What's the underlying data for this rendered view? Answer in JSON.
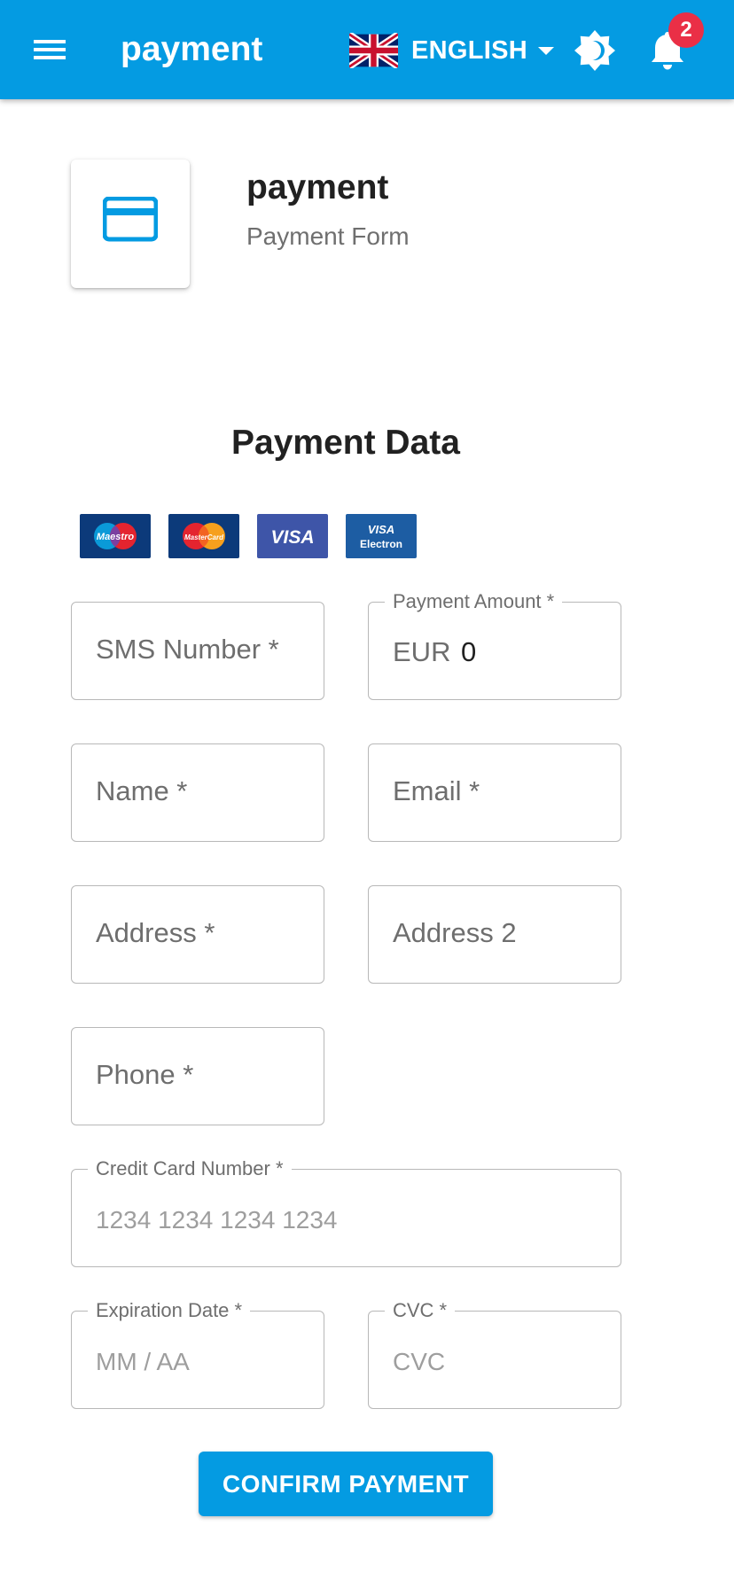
{
  "appbar": {
    "title": "payment",
    "language": "ENGLISH",
    "notification_count": "2",
    "background_color": "#049be2",
    "icons": {
      "menu": "hamburger-menu-icon",
      "flag": "uk-flag-icon",
      "theme": "brightness-toggle-icon",
      "notifications": "bell-icon"
    }
  },
  "header": {
    "icon": "credit-card-icon",
    "title": "payment",
    "subtitle": "Payment Form"
  },
  "form": {
    "section_title": "Payment Data",
    "card_brands": [
      {
        "name": "Maestro",
        "label": "Maestro"
      },
      {
        "name": "MasterCard",
        "label": "MasterCard"
      },
      {
        "name": "Visa",
        "label": "VISA"
      },
      {
        "name": "Visa Electron",
        "label_top": "VISA",
        "label_bottom": "Electron"
      }
    ],
    "sms_number": {
      "placeholder": "SMS Number *"
    },
    "payment_amount": {
      "label": "Payment Amount *",
      "currency": "EUR",
      "value": "0"
    },
    "name": {
      "placeholder": "Name *"
    },
    "email": {
      "placeholder": "Email *"
    },
    "address": {
      "placeholder": "Address *"
    },
    "address2": {
      "placeholder": "Address 2"
    },
    "phone": {
      "placeholder": "Phone *"
    },
    "card_number": {
      "label": "Credit Card Number *",
      "placeholder": "1234 1234 1234 1234"
    },
    "expiration": {
      "label": "Expiration Date *",
      "placeholder": "MM / AA"
    },
    "cvc": {
      "label": "CVC *",
      "placeholder": "CVC"
    },
    "confirm_label": "CONFIRM PAYMENT"
  }
}
